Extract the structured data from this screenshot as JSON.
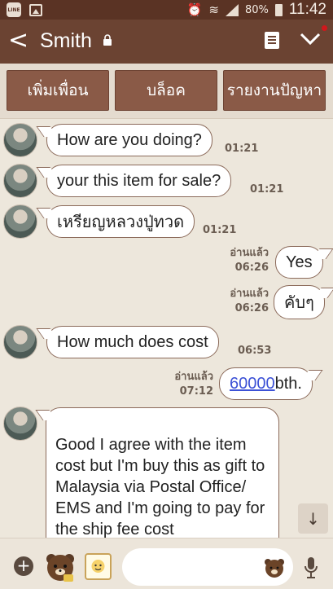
{
  "status_bar": {
    "line_app": "LINE",
    "battery": "80%",
    "time": "11:42"
  },
  "header": {
    "back": "<",
    "title": "Smith"
  },
  "actions": [
    "เพิ่มเพื่อน",
    "บล็อค",
    "รายงานปัญหา"
  ],
  "messages": [
    {
      "text": "How are you doing?",
      "time": "01:21"
    },
    {
      "text": "your this item for sale?",
      "time": "01:21"
    },
    {
      "text": "เหรียญหลวงปู่ทวด",
      "time": "01:21"
    },
    {
      "text": "Yes",
      "read": "อ่านแล้ว",
      "time": "06:26"
    },
    {
      "text": "คับๆ",
      "read": "อ่านแล้ว",
      "time": "06:26"
    },
    {
      "text": "How much does cost",
      "time": "06:53"
    },
    {
      "link": "60000",
      "suffix": " bth.",
      "read": "อ่านแล้ว",
      "time": "07:12"
    },
    {
      "text": "Good I agree with the item cost but I'm buy this as gift to Malaysia via Postal Office/ EMS and I'm going to pay for the ship fee cost"
    }
  ],
  "scroll_button": "↓",
  "input": {
    "plus": "+"
  }
}
